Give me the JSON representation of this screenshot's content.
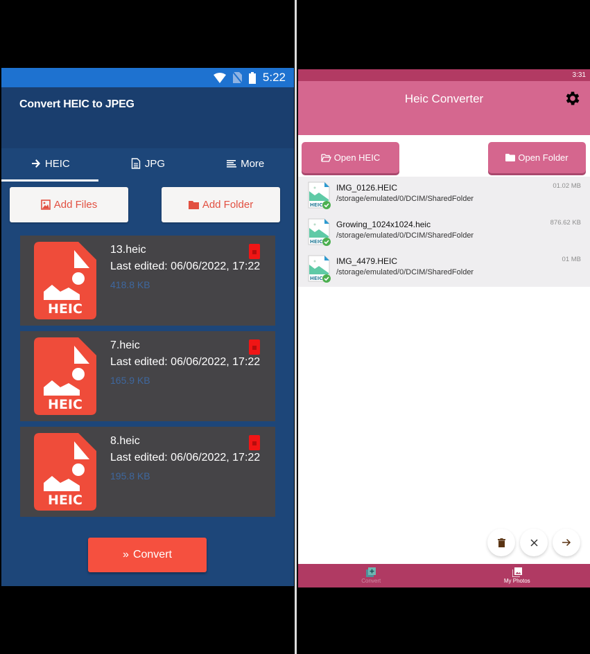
{
  "left_app": {
    "status_bar": {
      "time": "5:22",
      "icons": [
        "wifi-icon",
        "no-sim-icon",
        "battery-icon"
      ]
    },
    "title": "Convert HEIC to JPEG",
    "tabs": [
      {
        "label": "HEIC",
        "icon": "arrow-right-icon",
        "active": true
      },
      {
        "label": "JPG",
        "icon": "document-icon",
        "active": false
      },
      {
        "label": "More",
        "icon": "list-icon",
        "active": false
      }
    ],
    "actions": {
      "add_files": "Add Files",
      "add_folder": "Add Folder"
    },
    "files": [
      {
        "name": "13.heic",
        "last_edited": "Last edited: 06/06/2022, 17:22",
        "size": "418.8 KB",
        "badge": "HEIC"
      },
      {
        "name": "7.heic",
        "last_edited": "Last edited: 06/06/2022, 17:22",
        "size": "165.9 KB",
        "badge": "HEIC"
      },
      {
        "name": "8.heic",
        "last_edited": "Last edited: 06/06/2022, 17:22",
        "size": "195.8 KB",
        "badge": "HEIC"
      }
    ],
    "convert_label": "Convert",
    "colors": {
      "accent": "#f5503f",
      "background": "#1d4679",
      "status_bar": "#1e72d0"
    }
  },
  "right_app": {
    "status_bar": {
      "time": "3:31"
    },
    "title": "Heic Converter",
    "actions": {
      "open_heic": "Open HEIC",
      "open_folder": "Open Folder"
    },
    "files": [
      {
        "name": "IMG_0126.HEIC",
        "path": "/storage/emulated/0/DCIM/SharedFolder",
        "size": "01.02 MB",
        "badge": "HEIC"
      },
      {
        "name": "Growing_1024x1024.heic",
        "path": "/storage/emulated/0/DCIM/SharedFolder",
        "size": "876.62 KB",
        "badge": "HEIC"
      },
      {
        "name": "IMG_4479.HEIC",
        "path": "/storage/emulated/0/DCIM/SharedFolder",
        "size": "01 MB",
        "badge": "HEIC"
      }
    ],
    "fabs": [
      "delete-icon",
      "close-icon",
      "arrow-right-icon"
    ],
    "bottom_nav": [
      {
        "label": "Convert",
        "icon": "add-to-collection-icon",
        "active": false
      },
      {
        "label": "My Photos",
        "icon": "photo-library-icon",
        "active": true
      }
    ],
    "colors": {
      "primary": "#d5678f",
      "dark": "#b03a63"
    }
  }
}
